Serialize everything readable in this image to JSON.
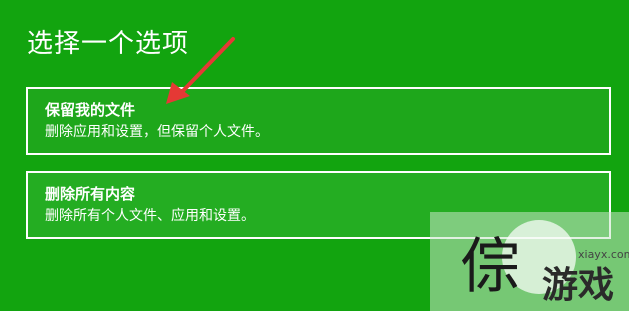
{
  "page": {
    "title": "选择一个选项"
  },
  "options": [
    {
      "title": "保留我的文件",
      "description": "删除应用和设置，但保留个人文件。"
    },
    {
      "title": "删除所有内容",
      "description": "删除所有个人文件、应用和设置。"
    }
  ],
  "watermark": {
    "domain": "xiayx.com",
    "game_text": "游戏"
  },
  "colors": {
    "background": "#12a40f",
    "annotation_arrow": "#e53935"
  },
  "icons": {
    "annotation": "red-arrow-icon"
  }
}
